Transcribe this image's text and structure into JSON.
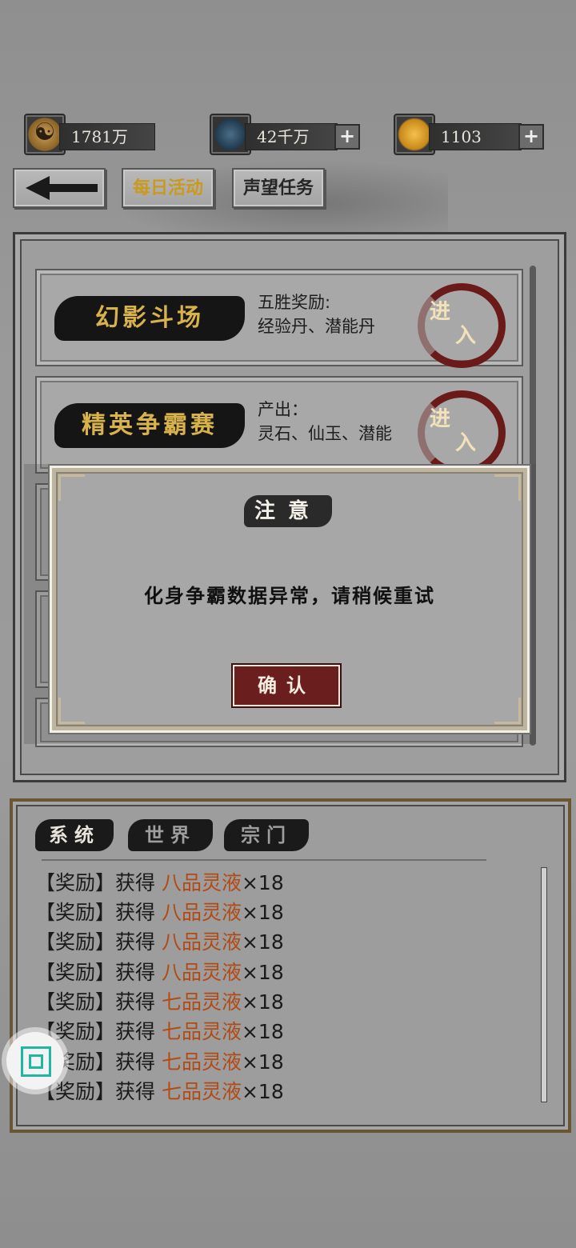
{
  "resources": [
    {
      "icon": "taiji-coin-icon",
      "value": "1781万",
      "has_plus": false
    },
    {
      "icon": "blue-crystal-icon",
      "value": "42千万",
      "has_plus": true
    },
    {
      "icon": "gold-ingot-icon",
      "value": "1103",
      "has_plus": true
    }
  ],
  "plus_label": "+",
  "nav": {
    "daily_label": "每日活动",
    "reputation_label": "声望任务"
  },
  "activities": [
    {
      "name": "幻影斗场",
      "desc_line1": "五胜奖励:",
      "desc_line2": "经验丹、潜能丹",
      "enter_a": "进",
      "enter_b": "入"
    },
    {
      "name": "精英争霸赛",
      "desc_line1": "产出：",
      "desc_line2": "灵石、仙玉、潜能",
      "enter_a": "进",
      "enter_b": "入"
    }
  ],
  "dialog": {
    "title": "注意",
    "message": "化身争霸数据异常，请稍候重试",
    "confirm_label": "确认"
  },
  "chat": {
    "tabs": [
      "系统",
      "世界",
      "宗门"
    ],
    "lines": [
      {
        "prefix": "【奖励】获得 ",
        "item": "八品灵液",
        "suffix": "×18"
      },
      {
        "prefix": "【奖励】获得 ",
        "item": "八品灵液",
        "suffix": "×18"
      },
      {
        "prefix": "【奖励】获得 ",
        "item": "八品灵液",
        "suffix": "×18"
      },
      {
        "prefix": "【奖励】获得 ",
        "item": "八品灵液",
        "suffix": "×18"
      },
      {
        "prefix": "【奖励】获得 ",
        "item": "七品灵液",
        "suffix": "×18"
      },
      {
        "prefix": "【奖励】获得 ",
        "item": "七品灵液",
        "suffix": "×18"
      },
      {
        "prefix": "【奖励】获得 ",
        "item": "七品灵液",
        "suffix": "×18"
      },
      {
        "prefix": "【奖励】获得 ",
        "item": "七品灵液",
        "suffix": "×18"
      }
    ]
  },
  "colors": {
    "item_highlight": "#b34a14",
    "card_title_gold": "#d8b24a",
    "confirm_red": "#6b1e1e"
  }
}
